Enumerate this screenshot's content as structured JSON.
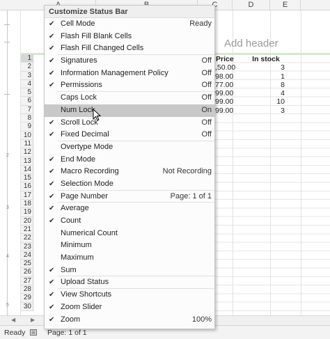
{
  "sheet": {
    "columns": [
      "A",
      "B",
      "C",
      "D",
      "E"
    ],
    "add_header": "Add header",
    "table_header": {
      "price": "Price",
      "stock": "In stock"
    },
    "rows": [
      {
        "price": ",50.00",
        "stock": "3"
      },
      {
        "price": "98.00",
        "stock": "1"
      },
      {
        "price": "77.00",
        "stock": "8"
      },
      {
        "price": "99.00",
        "stock": "4"
      },
      {
        "price": "99.00",
        "stock": "10"
      },
      {
        "price": "99.00",
        "stock": "3"
      }
    ],
    "row_numbers": [
      "1",
      "2",
      "3",
      "4",
      "5",
      "6",
      "7",
      "8",
      "9",
      "10",
      "11",
      "12",
      "13",
      "14",
      "15",
      "16",
      "17",
      "18",
      "19",
      "20",
      "21",
      "22",
      "23",
      "24",
      "25",
      "26",
      "27",
      "28",
      "29",
      "30"
    ],
    "ruler_marks": [
      "2",
      "3",
      "4",
      "5"
    ]
  },
  "status_bar": {
    "ready": "Ready",
    "page": "Page: 1 of 1"
  },
  "menu": {
    "title": "Customize Status Bar",
    "items": [
      {
        "label": "Cell Mode",
        "value": "Ready",
        "checked": true
      },
      {
        "label": "Flash Fill Blank Cells",
        "value": "",
        "checked": true
      },
      {
        "label": "Flash Fill Changed Cells",
        "value": "",
        "checked": true
      },
      {
        "label": "Signatures",
        "value": "Off",
        "checked": true
      },
      {
        "label": "Information Management Policy",
        "value": "Off",
        "checked": true
      },
      {
        "label": "Permissions",
        "value": "Off",
        "checked": true
      },
      {
        "label": "Caps Lock",
        "value": "Off",
        "checked": false
      },
      {
        "label": "Num Lock",
        "value": "On",
        "checked": false
      },
      {
        "label": "Scroll Lock",
        "value": "Off",
        "checked": true
      },
      {
        "label": "Fixed Decimal",
        "value": "Off",
        "checked": true
      },
      {
        "label": "Overtype Mode",
        "value": "",
        "checked": false
      },
      {
        "label": "End Mode",
        "value": "",
        "checked": true
      },
      {
        "label": "Macro Recording",
        "value": "Not Recording",
        "checked": true
      },
      {
        "label": "Selection Mode",
        "value": "",
        "checked": true
      },
      {
        "label": "Page Number",
        "value": "Page: 1 of 1",
        "checked": true
      },
      {
        "label": "Average",
        "value": "",
        "checked": true
      },
      {
        "label": "Count",
        "value": "",
        "checked": true
      },
      {
        "label": "Numerical Count",
        "value": "",
        "checked": false
      },
      {
        "label": "Minimum",
        "value": "",
        "checked": false
      },
      {
        "label": "Maximum",
        "value": "",
        "checked": false
      },
      {
        "label": "Sum",
        "value": "",
        "checked": true
      },
      {
        "label": "Upload Status",
        "value": "",
        "checked": true
      },
      {
        "label": "View Shortcuts",
        "value": "",
        "checked": true
      },
      {
        "label": "Zoom Slider",
        "value": "",
        "checked": true
      },
      {
        "label": "Zoom",
        "value": "100%",
        "checked": true
      }
    ],
    "check_glyph": "✔",
    "hovered_item": "Num Lock"
  },
  "colors": {
    "menu_hover": "#c8c8c8",
    "row_highlight": "#d5e8cf"
  }
}
